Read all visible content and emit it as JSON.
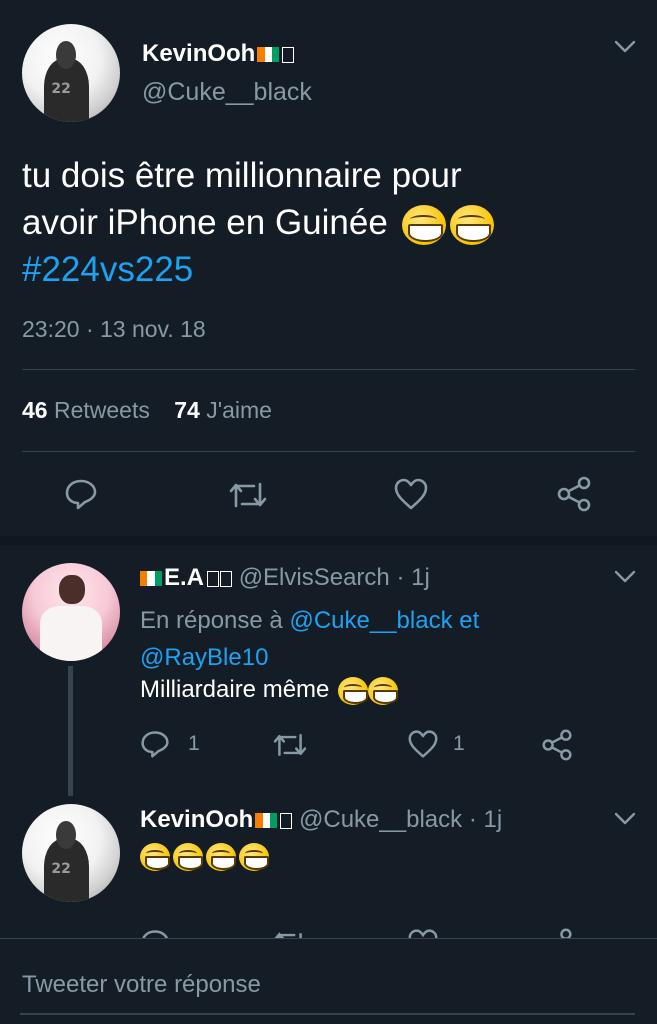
{
  "tweet": {
    "display_name": "KevinOoh",
    "handle": "@Cuke__black",
    "text_line1": "tu dois être millionnaire pour",
    "text_line2": "avoir  iPhone en Guinée",
    "hashtag": "#224vs225",
    "timestamp": "23:20 · 13 nov. 18",
    "retweets_count": "46",
    "retweets_label": "Retweets",
    "likes_count": "74",
    "likes_label": "J'aime"
  },
  "replies": [
    {
      "display_name": "E.A",
      "handle": "@ElvisSearch",
      "age": "· 1j",
      "in_reply_prefix": "En réponse à",
      "in_reply_links": "@Cuke__black et",
      "in_reply_link2": "@RayBle10",
      "text": "Milliardaire même",
      "reply_count": "1",
      "like_count": "1"
    },
    {
      "display_name": "KevinOoh",
      "handle": "@Cuke__black",
      "age": "· 1j"
    }
  ],
  "composer": {
    "placeholder": "Tweeter votre réponse"
  },
  "colors": {
    "background": "#141d26",
    "muted": "#8899a6",
    "link": "#1da1f2",
    "divider": "#38444d"
  },
  "icons": [
    "chevron-down-icon",
    "reply-icon",
    "retweet-icon",
    "like-icon",
    "share-icon",
    "flag-icon",
    "tears-of-joy-emoji"
  ]
}
